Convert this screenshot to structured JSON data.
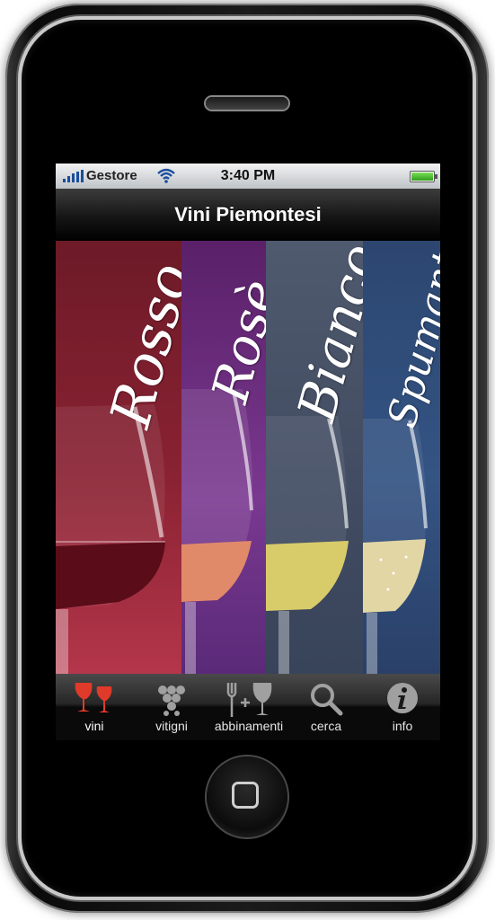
{
  "status_bar": {
    "carrier": "Gestore",
    "time": "3:40 PM"
  },
  "nav_bar": {
    "title": "Vini Piemontesi"
  },
  "wine_categories": [
    {
      "label": "Rosso",
      "color": "#7a1f2c"
    },
    {
      "label": "Rosè",
      "color": "#6b2a78"
    },
    {
      "label": "Bianco",
      "color": "#4a5468"
    },
    {
      "label": "Spumante",
      "color": "#2e4a72"
    }
  ],
  "tab_bar": {
    "selected": "vini",
    "accent_color": "#e03a2a",
    "items": [
      {
        "label": "vini",
        "icon": "wine-glasses-icon"
      },
      {
        "label": "vitigni",
        "icon": "grapes-icon"
      },
      {
        "label": "abbinamenti",
        "icon": "fork-plus-glass-icon"
      },
      {
        "label": "cerca",
        "icon": "magnifier-icon"
      },
      {
        "label": "info",
        "icon": "info-icon"
      }
    ]
  }
}
